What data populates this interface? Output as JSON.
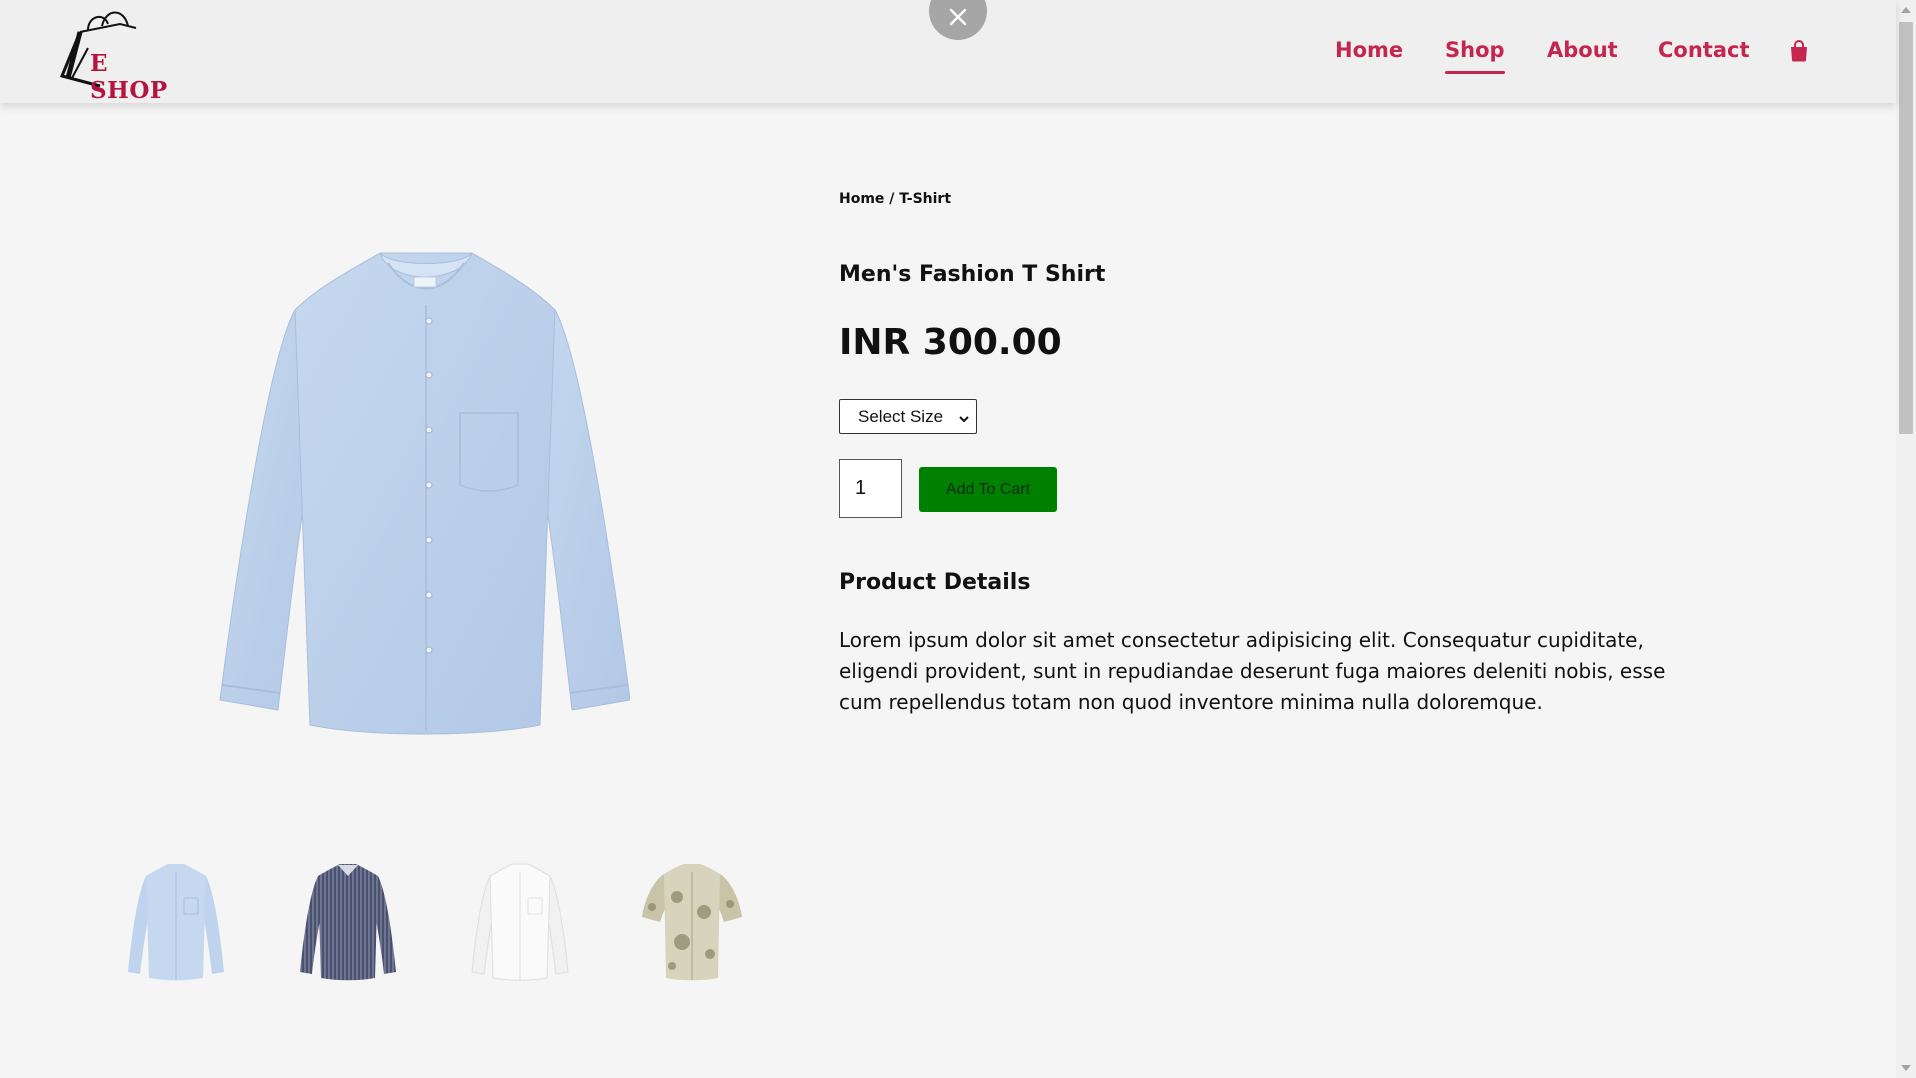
{
  "header": {
    "logo_text": "E SHOP",
    "nav": [
      {
        "label": "Home",
        "active": false
      },
      {
        "label": "Shop",
        "active": true
      },
      {
        "label": "About",
        "active": false
      },
      {
        "label": "Contact",
        "active": false
      }
    ],
    "cart_icon": "shopping-bag-icon",
    "accent_color": "#c4264f"
  },
  "close_button": {
    "icon": "close-icon",
    "color": "#a6a6a6"
  },
  "product": {
    "breadcrumb": "Home / T-Shirt",
    "title": "Men's Fashion T Shirt",
    "price": "INR 300.00",
    "size_select": {
      "selected": "Select Size"
    },
    "quantity": "1",
    "add_to_cart_label": "Add To Cart",
    "add_to_cart_color": "#008000",
    "details_heading": "Product Details",
    "details_text": "Lorem ipsum dolor sit amet consectetur adipisicing elit. Consequatur cupiditate, eligendi provident, sunt in repudiandae deserunt fuga maiores deleniti nobis, esse cum repellendus totam non quod inventore minima nulla doloremque.",
    "thumbnails": [
      {
        "name": "light-blue-shirt"
      },
      {
        "name": "striped-navy-shirt"
      },
      {
        "name": "white-shirt"
      },
      {
        "name": "floral-print-shirt"
      }
    ]
  }
}
